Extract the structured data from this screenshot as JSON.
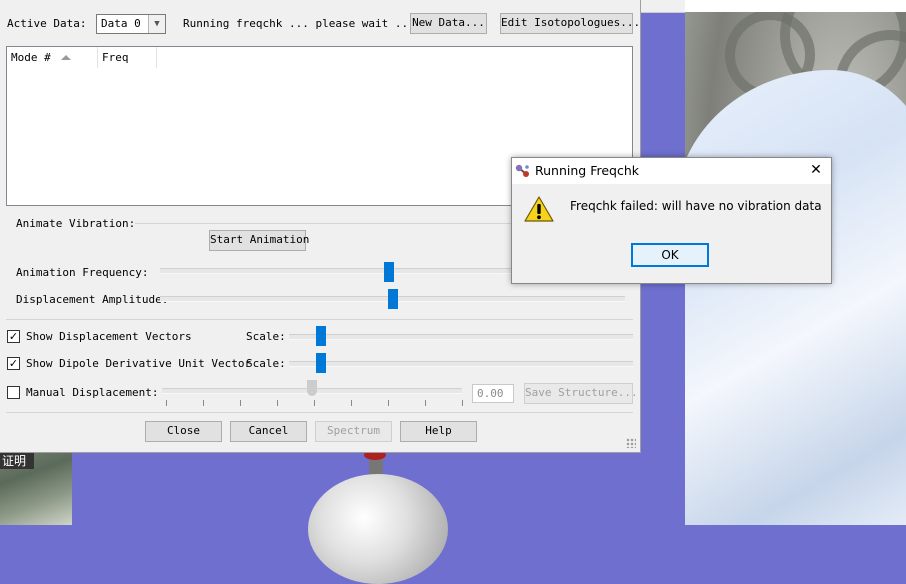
{
  "header": {
    "active_data_label": "Active Data:",
    "active_data_value": "Data 0",
    "status_text": "Running freqchk ... please wait ....",
    "new_data_button": "New Data...",
    "edit_isotopologues_button": "Edit Isotopologues..."
  },
  "table": {
    "columns": [
      "Mode #",
      "Freq"
    ]
  },
  "animation": {
    "section_label": "Animate Vibration:",
    "start_button": "Start Animation",
    "frequency_label": "Animation Frequency:",
    "frequency_level": 0.65,
    "amplitude_label": "Displacement Amplitude:",
    "amplitude_level": 0.5
  },
  "vectors": {
    "show_displacement_label": "Show Displacement Vectors",
    "show_displacement_checked": true,
    "displacement_scale_label": "Scale:",
    "displacement_scale_level": 0.08,
    "show_dipole_label": "Show Dipole Derivative Unit Vector",
    "show_dipole_checked": true,
    "dipole_scale_label": "Scale:",
    "dipole_scale_level": 0.08,
    "manual_displacement_label": "Manual Displacement:",
    "manual_displacement_checked": false,
    "manual_value": "0.00",
    "save_structure_button": "Save Structure..."
  },
  "footer": {
    "close_button": "Close",
    "cancel_button": "Cancel",
    "spectrum_button": "Spectrum",
    "help_button": "Help"
  },
  "message_box": {
    "title": "Running Freqchk",
    "message": "Freqchk failed:  will have no vibration data",
    "ok_button": "OK",
    "close_glyph": "✕",
    "icon": "warning-icon"
  },
  "background": {
    "left_text": "证明"
  },
  "colors": {
    "accent": "#0078d7",
    "desktop": "#6e6fcf",
    "warning": "#f7d21c"
  }
}
